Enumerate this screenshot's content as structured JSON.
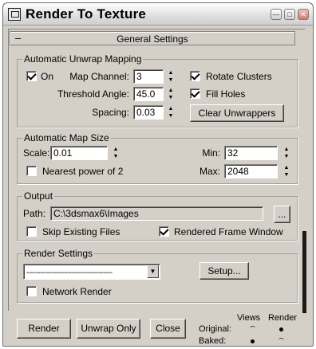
{
  "window": {
    "title": "Render To Texture"
  },
  "rollout": {
    "toggle": "–",
    "title": "General Settings"
  },
  "unwrap": {
    "group_label": "Automatic Unwrap Mapping",
    "on_label": "On",
    "on_checked": true,
    "map_channel_label": "Map Channel:",
    "map_channel_value": "3",
    "rotate_clusters_label": "Rotate Clusters",
    "rotate_clusters_checked": true,
    "threshold_angle_label": "Threshold Angle:",
    "threshold_angle_value": "45.0",
    "fill_holes_label": "Fill Holes",
    "fill_holes_checked": true,
    "spacing_label": "Spacing:",
    "spacing_value": "0.03",
    "clear_unwrappers_label": "Clear Unwrappers"
  },
  "mapsize": {
    "group_label": "Automatic Map Size",
    "scale_label": "Scale:",
    "scale_value": "0.01",
    "min_label": "Min:",
    "min_value": "32",
    "nearest_power_label": "Nearest power of 2",
    "nearest_power_checked": false,
    "max_label": "Max:",
    "max_value": "2048"
  },
  "output": {
    "group_label": "Output",
    "path_label": "Path:",
    "path_value": "C:\\3dsmax6\\Images",
    "browse_label": "...",
    "skip_existing_label": "Skip Existing Files",
    "skip_existing_checked": false,
    "rendered_frame_label": "Rendered Frame Window",
    "rendered_frame_checked": true
  },
  "render_settings": {
    "group_label": "Render Settings",
    "preset_value": "--------------------------------------",
    "setup_label": "Setup...",
    "network_render_label": "Network Render",
    "network_render_checked": false
  },
  "footer": {
    "render_label": "Render",
    "unwrap_only_label": "Unwrap Only",
    "close_label": "Close",
    "views_label": "Views",
    "render_col_label": "Render",
    "original_label": "Original:",
    "baked_label": "Baked:",
    "original_views": false,
    "original_render": true,
    "baked_views": true,
    "baked_render": false
  },
  "icons": [
    "app-icon",
    "minimize-icon",
    "maximize-icon",
    "close-icon",
    "spinner-up-icon",
    "spinner-down-icon",
    "dropdown-arrow-icon",
    "checkmark-icon"
  ]
}
